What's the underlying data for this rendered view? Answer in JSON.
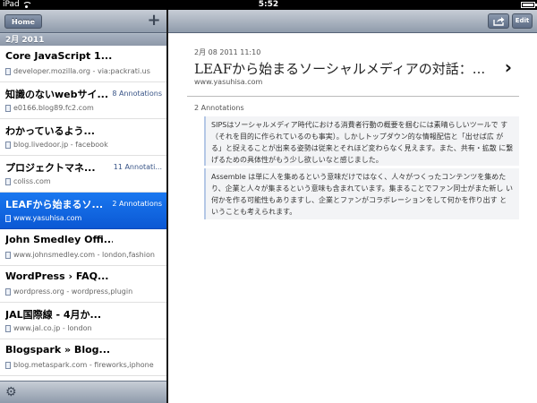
{
  "status_bar": {
    "device": "iPad",
    "time": "5:52"
  },
  "left_toolbar": {
    "home_label": "Home",
    "add_label": "+"
  },
  "section_header": "2月 2011",
  "list": [
    {
      "title": "Core JavaScript 1....",
      "count": "",
      "source": "developer.mozilla.org - via:packrati.us",
      "selected": false
    },
    {
      "title": "知識のないwebサイ...",
      "count": "8 Annotations",
      "source": "e0166.blog89.fc2.com",
      "selected": false
    },
    {
      "title": "わかっているよう...",
      "count": "",
      "source": "blog.livedoor.jp - facebook",
      "selected": false
    },
    {
      "title": "プロジェクトマネ...",
      "count": "11 Annotati...",
      "source": "coliss.com",
      "selected": false
    },
    {
      "title": "LEAFから始まるソ...",
      "count": "2 Annotations",
      "source": "www.yasuhisa.com",
      "selected": true
    },
    {
      "title": "John Smedley Offi...",
      "count": "",
      "source": "www.johnsmedley.com - london,fashion",
      "selected": false
    },
    {
      "title": "WordPress › FAQ...",
      "count": "",
      "source": "wordpress.org - wordpress,plugin",
      "selected": false
    },
    {
      "title": "JAL国際線 - 4月か...",
      "count": "",
      "source": "www.jal.co.jp - london",
      "selected": false
    },
    {
      "title": "Blogspark » Blog...",
      "count": "",
      "source": "blog.metaspark.com - fireworks,iphone",
      "selected": false
    }
  ],
  "right_toolbar": {
    "edit_label": "Edit"
  },
  "article": {
    "date": "2月 08 2011 11:10",
    "title": "LEAFから始まるソーシャルメディアの対話：...",
    "url": "www.yasuhisa.com",
    "annotation_count": "2 Annotations",
    "annotations": [
      "SIPSはソーシャルメディア時代における消費者行動の概要を掴むには素晴らしいツールで す（それを目的に作られているのも事実）。しかしトップダウン的な情報配信と「出せば広 がる」と捉えることが出来る姿勢は従来とそれほど変わらなく見えます。また、共有・拡散 に繋げるための具体性がもう少し欲しいなと感じました。",
      "Assemble は単に人を集めるという意味だけではなく、人々がつくったコンテンツを集めた り、企業と人々が集まるという意味も含まれています。集まることでファン同士がまた新し い何かを作る可能性もありますし、企業とファンがコラボレーションをして何かを作り出す ということも考えられます。"
    ]
  }
}
